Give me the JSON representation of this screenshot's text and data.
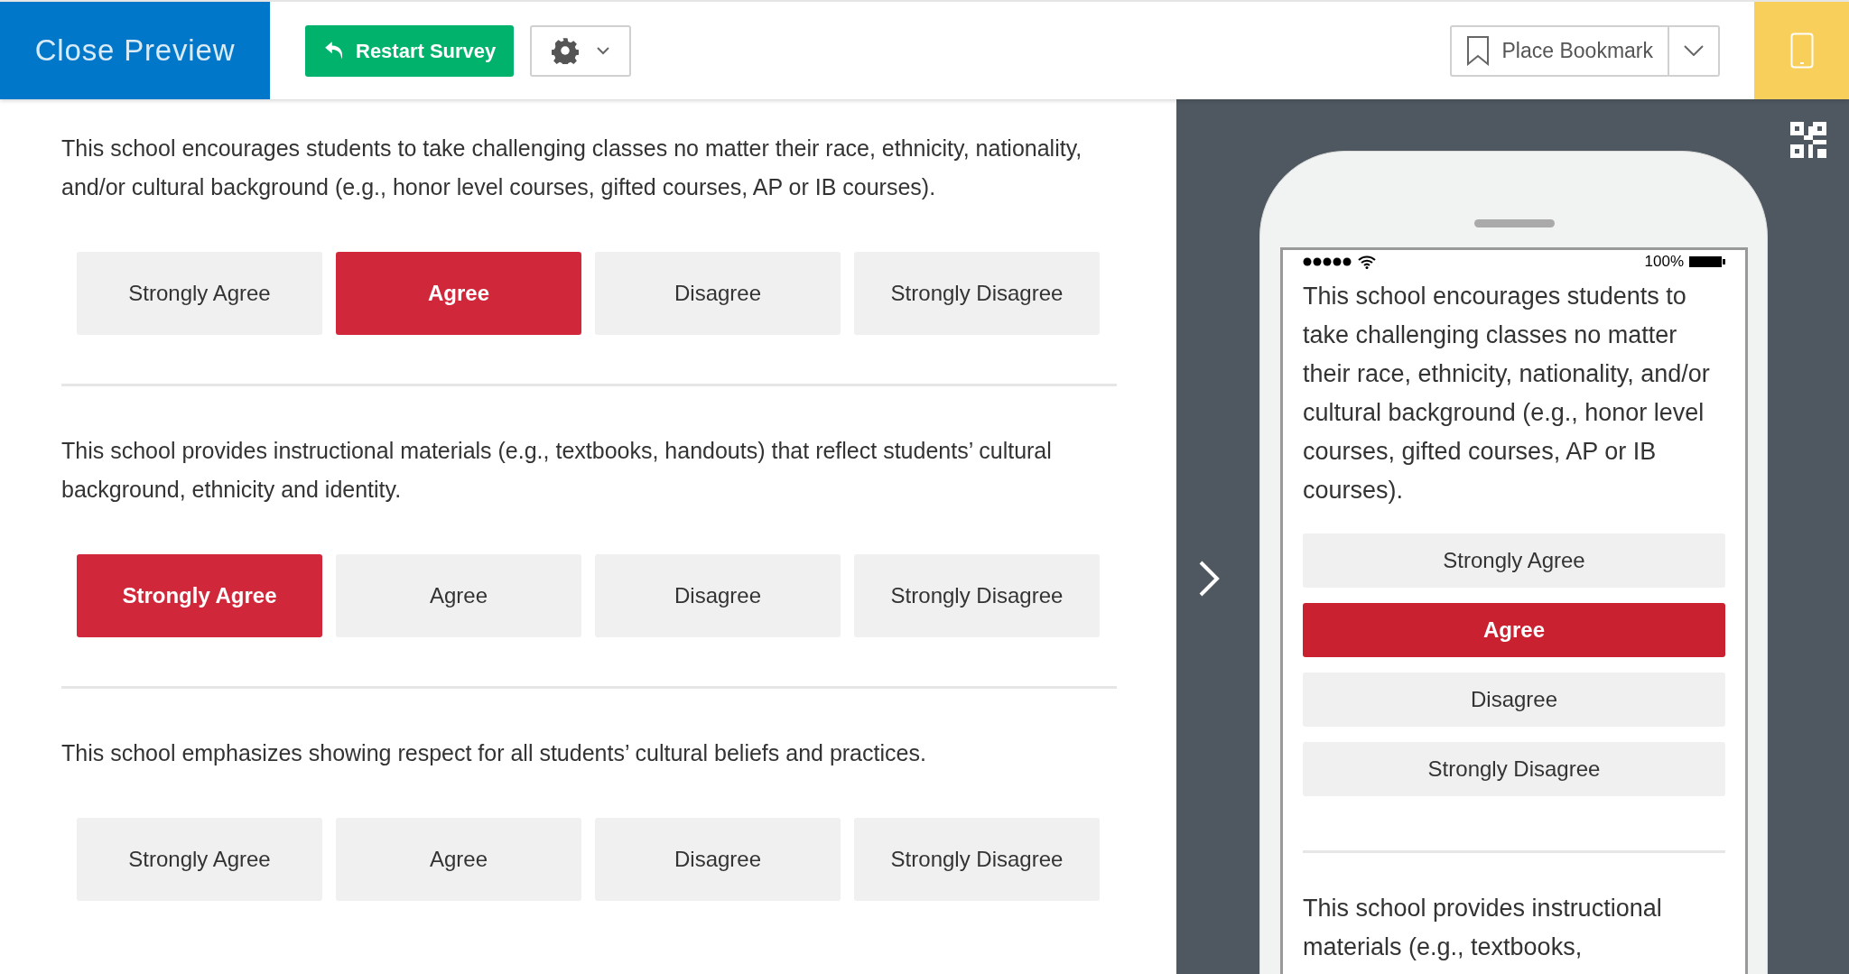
{
  "header": {
    "close_label": "Close Preview",
    "restart_label": "Restart Survey",
    "bookmark_label": "Place Bookmark"
  },
  "questions": [
    {
      "text": "This school encourages students to take challenging classes no matter their race, ethnicity, nationality, and/or cultural background (e.g., honor level courses, gifted courses, AP or IB courses).",
      "options": [
        {
          "label": "Strongly Agree",
          "selected": false
        },
        {
          "label": "Agree",
          "selected": true
        },
        {
          "label": "Disagree",
          "selected": false
        },
        {
          "label": "Strongly Disagree",
          "selected": false
        }
      ]
    },
    {
      "text": "This school provides instructional materials (e.g., textbooks, handouts) that reflect students’ cultural background, ethnicity and identity.",
      "options": [
        {
          "label": "Strongly Agree",
          "selected": true
        },
        {
          "label": "Agree",
          "selected": false
        },
        {
          "label": "Disagree",
          "selected": false
        },
        {
          "label": "Strongly Disagree",
          "selected": false
        }
      ]
    },
    {
      "text": "This school emphasizes showing respect for all students’ cultural beliefs and practices.",
      "options": [
        {
          "label": "Strongly Agree",
          "selected": false
        },
        {
          "label": "Agree",
          "selected": false
        },
        {
          "label": "Disagree",
          "selected": false
        },
        {
          "label": "Strongly Disagree",
          "selected": false
        }
      ]
    }
  ],
  "phone": {
    "battery_text": "100%",
    "questions": [
      {
        "text": "This school encourages students to take challenging classes no matter their race, ethnicity, nationality, and/or cultural background (e.g., honor level courses, gifted courses, AP or IB courses).",
        "options": [
          {
            "label": "Strongly Agree",
            "selected": false
          },
          {
            "label": "Agree",
            "selected": true
          },
          {
            "label": "Disagree",
            "selected": false
          },
          {
            "label": "Strongly Disagree",
            "selected": false
          }
        ]
      },
      {
        "text": "This school provides instructional materials (e.g., textbooks,"
      }
    ]
  }
}
